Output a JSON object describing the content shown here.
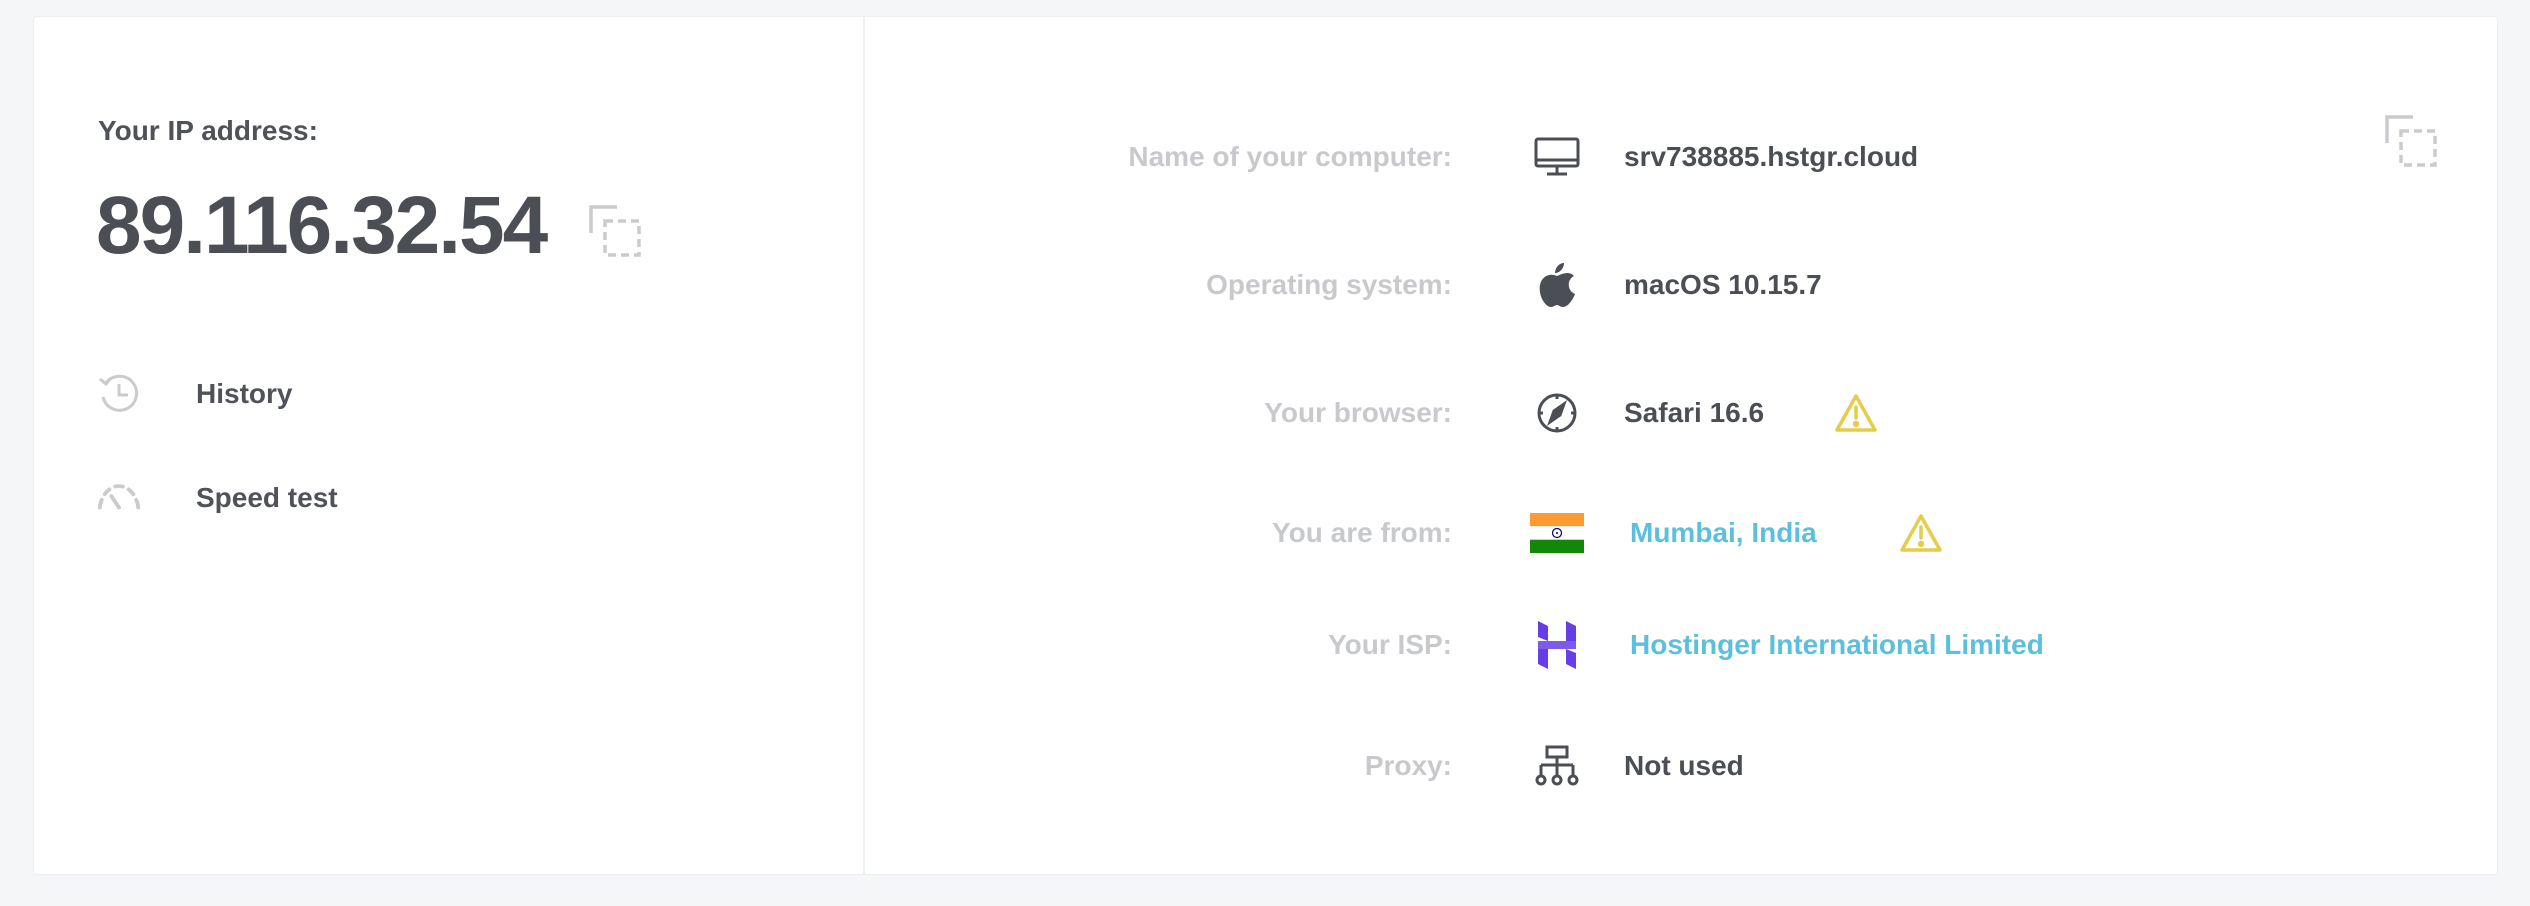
{
  "ip_panel": {
    "label": "Your IP address:",
    "ip": "89.116.32.54",
    "copy_icon": "copy-icon"
  },
  "nav": [
    {
      "label": "History",
      "icon": "history-icon"
    },
    {
      "label": "Speed test",
      "icon": "speedometer-icon"
    }
  ],
  "details": {
    "computer": {
      "key": "Name of your computer:",
      "value": "srv738885.hstgr.cloud",
      "icon": "monitor-icon"
    },
    "os": {
      "key": "Operating system:",
      "value": "macOS 10.15.7",
      "icon": "apple-icon"
    },
    "browser": {
      "key": "Your browser:",
      "value": "Safari 16.6",
      "icon": "compass-icon",
      "warning": true
    },
    "location": {
      "key": "You are from:",
      "value": "Mumbai, India",
      "icon": "india-flag-icon",
      "warning": true
    },
    "isp": {
      "key": "Your ISP:",
      "value": "Hostinger International Limited",
      "icon": "hostinger-logo-icon"
    },
    "proxy": {
      "key": "Proxy:",
      "value": "Not used",
      "icon": "network-icon"
    }
  },
  "colors": {
    "text_dark": "#4b4f55",
    "text_muted": "#c7c9cd",
    "link": "#5bc0de",
    "warning": "#e3cd4a",
    "hostinger": "#673de6",
    "flag_saffron": "#ff9933",
    "flag_green": "#138808",
    "chakra": "#000080"
  }
}
